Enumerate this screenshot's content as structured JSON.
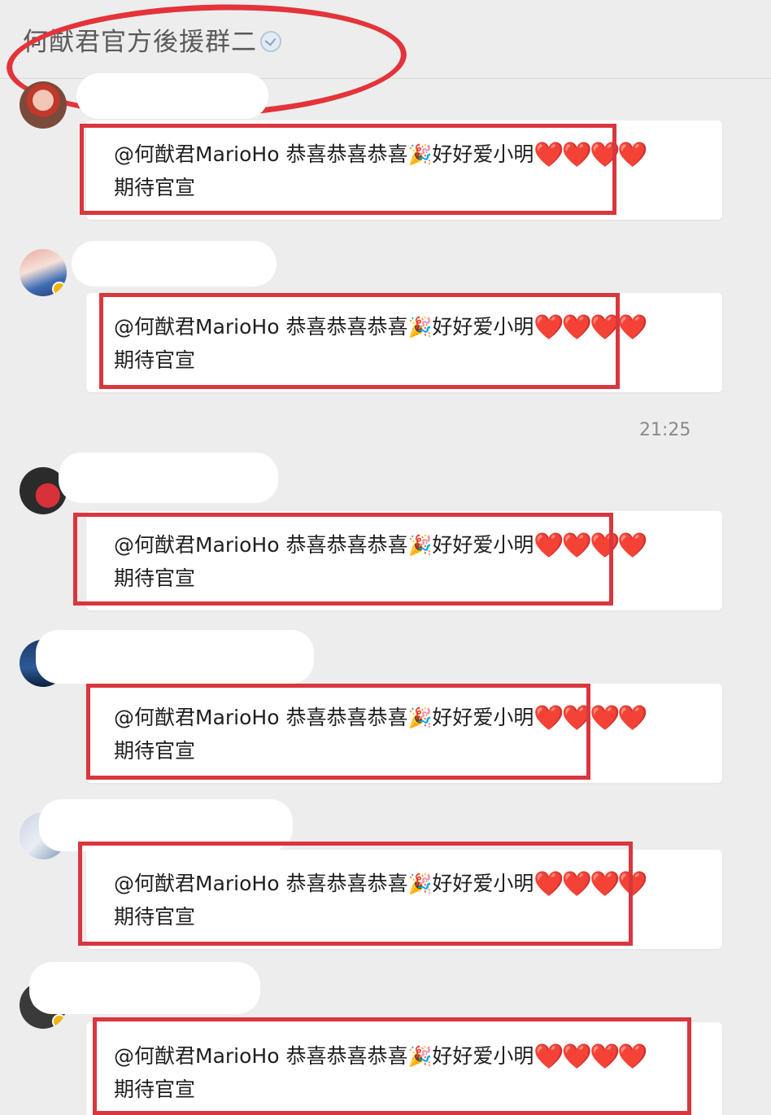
{
  "header": {
    "title": "何猷君官方後援群二",
    "verified_icon": "verified-badge-icon"
  },
  "messages": [
    {
      "text_line1": "@何猷君MarioHo 恭喜恭喜恭喜",
      "party_icon": "🎉",
      "text_mid": "好好爱小明",
      "hearts": "❤️❤️❤️❤️",
      "text_line2": "期待官宣"
    },
    {
      "text_line1": "@何猷君MarioHo 恭喜恭喜恭喜",
      "party_icon": "🎉",
      "text_mid": "好好爱小明",
      "hearts": "❤️❤️❤️❤️",
      "text_line2": "期待官宣"
    },
    {
      "text_line1": "@何猷君MarioHo 恭喜恭喜恭喜",
      "party_icon": "🎉",
      "text_mid": "好好爱小明",
      "hearts": "❤️❤️❤️❤️",
      "text_line2": "期待官宣"
    },
    {
      "text_line1": "@何猷君MarioHo 恭喜恭喜恭喜",
      "party_icon": "🎉",
      "text_mid": "好好爱小明",
      "hearts": "❤️❤️❤️❤️",
      "text_line2": "期待官宣"
    },
    {
      "text_line1": "@何猷君MarioHo 恭喜恭喜恭喜",
      "party_icon": "🎉",
      "text_mid": "好好爱小明",
      "hearts": "❤️❤️❤️❤️",
      "text_line2": "期待官宣"
    },
    {
      "text_line1": "@何猷君MarioHo 恭喜恭喜恭喜",
      "party_icon": "🎉",
      "text_mid": "好好爱小明",
      "hearts": "❤️❤️❤️❤️",
      "text_line2": "期待官宣"
    }
  ],
  "timestamp": "21:25",
  "colors": {
    "annotation_red": "#e2343a",
    "heart_red": "#e8232a",
    "background": "#ededed",
    "bubble": "#ffffff"
  }
}
